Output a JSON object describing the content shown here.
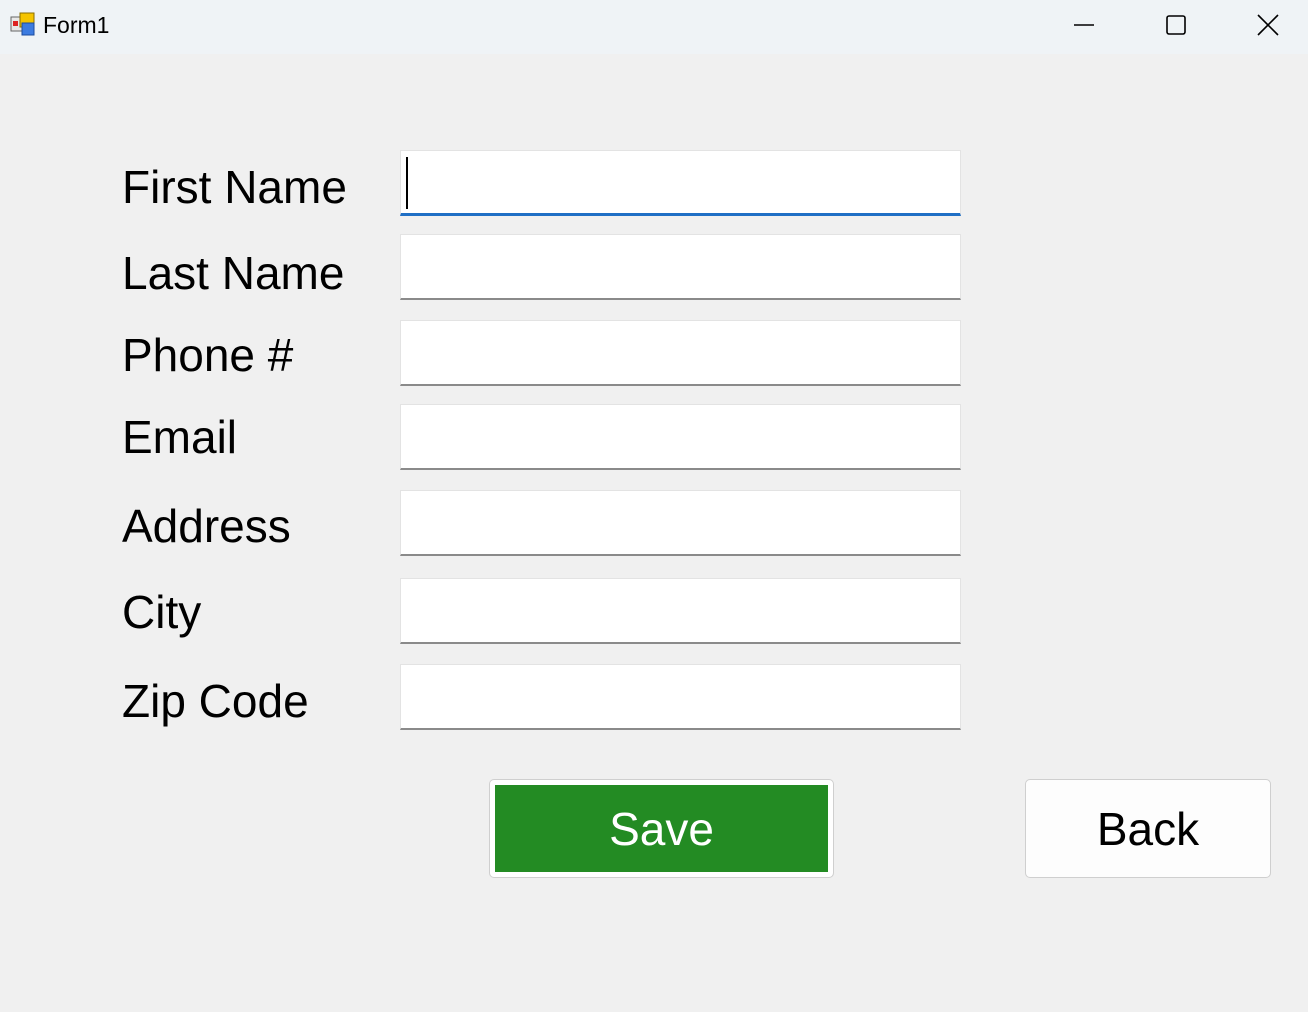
{
  "window": {
    "title": "Form1",
    "icon": "winforms-app-icon",
    "controls": {
      "minimize_icon": "minimize-icon",
      "maximize_icon": "maximize-icon",
      "close_icon": "close-icon"
    }
  },
  "form": {
    "fields": [
      {
        "label": "First Name",
        "value": "",
        "focused": true
      },
      {
        "label": "Last Name",
        "value": ""
      },
      {
        "label": "Phone #",
        "value": ""
      },
      {
        "label": "Email",
        "value": ""
      },
      {
        "label": "Address",
        "value": ""
      },
      {
        "label": "City",
        "value": ""
      },
      {
        "label": "Zip Code",
        "value": ""
      }
    ],
    "save_label": "Save",
    "back_label": "Back"
  },
  "colors": {
    "save_button": "#238b23",
    "focus_underline": "#1f6fc5",
    "window_background": "#f0f0f0"
  }
}
